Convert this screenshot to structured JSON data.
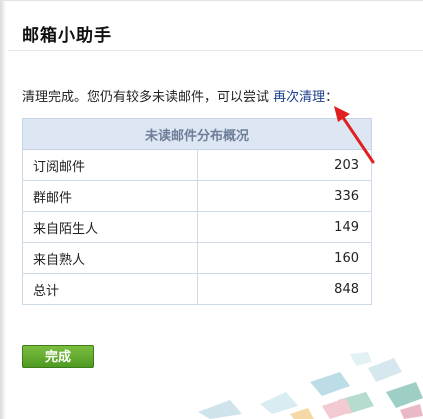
{
  "dialog": {
    "title": "邮箱小助手"
  },
  "message": {
    "prefix": "清理完成。您仍有较多未读邮件，可以尝试",
    "link": "再次清理",
    "suffix": "："
  },
  "table": {
    "header": "未读邮件分布概况",
    "rows": [
      {
        "category": "订阅邮件",
        "count": "203"
      },
      {
        "category": "群邮件",
        "count": "336"
      },
      {
        "category": "来自陌生人",
        "count": "149"
      },
      {
        "category": "来自熟人",
        "count": "160"
      },
      {
        "category": "总计",
        "count": "848"
      }
    ]
  },
  "actions": {
    "done_label": "完成"
  },
  "colors": {
    "link": "#1a3e8c",
    "table_header_bg": "#dde6f3",
    "button_green": "#5aa52b",
    "annotation_arrow": "#e02020"
  },
  "icons": {
    "annotation": "red-arrow-icon"
  }
}
